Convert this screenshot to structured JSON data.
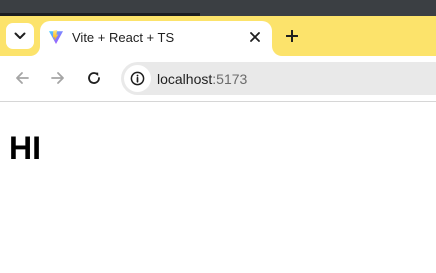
{
  "browser": {
    "tab": {
      "title": "Vite + React + TS",
      "favicon": "vite-logo-icon"
    },
    "icons": {
      "tab_search": "chevron-down-icon",
      "close": "close-icon",
      "new_tab": "plus-icon",
      "back": "arrow-left-icon",
      "forward": "arrow-right-icon",
      "reload": "reload-icon",
      "site_info": "info-icon"
    },
    "address_bar": {
      "host": "localhost",
      "port": ":5173"
    },
    "colors": {
      "tab_strip": "#fce36b",
      "window_frame": "#3b3f43",
      "omnibox": "#e9e9e9"
    }
  },
  "page": {
    "heading": "HI"
  }
}
